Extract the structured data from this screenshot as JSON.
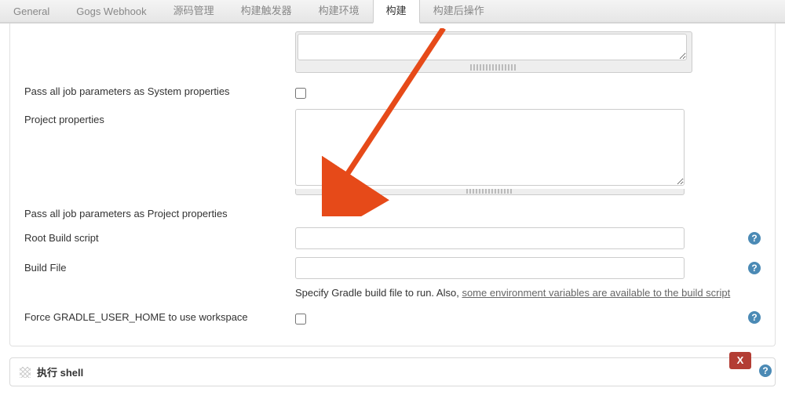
{
  "tabs": [
    "General",
    "Gogs Webhook",
    "源码管理",
    "构建触发器",
    "构建环境",
    "构建",
    "构建后操作"
  ],
  "active_tab_index": 5,
  "fields": {
    "top_textarea": "",
    "pass_system_label": "Pass all job parameters as System properties",
    "pass_system_checked": false,
    "project_props_label": "Project properties",
    "project_props_value": "",
    "pass_project_label": "Pass all job parameters as Project properties",
    "pass_project_checked": true,
    "root_build_label": "Root Build script",
    "root_build_value": "",
    "build_file_label": "Build File",
    "build_file_value": "",
    "build_file_help_prefix": "Specify Gradle build file to run. Also, ",
    "build_file_help_link": "some environment variables are available to the build script",
    "force_home_label": "Force GRADLE_USER_HOME to use workspace",
    "force_home_checked": false
  },
  "shell_section_title": "执行 shell",
  "delete_btn": "X",
  "help_glyph": "?"
}
